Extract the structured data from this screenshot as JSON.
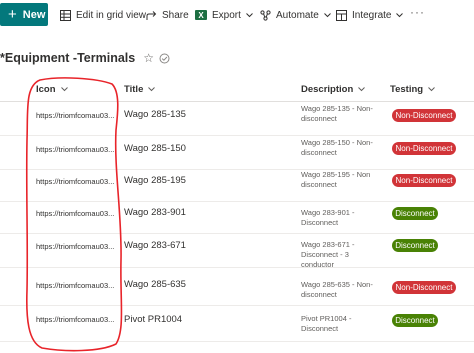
{
  "toolbar": {
    "new_label": "New",
    "edit_grid_label": "Edit in grid view",
    "share_label": "Share",
    "export_label": "Export",
    "automate_label": "Automate",
    "integrate_label": "Integrate",
    "more_label": "···"
  },
  "list": {
    "title": "*Equipment -Terminals",
    "star": "☆"
  },
  "columns": {
    "icon": "Icon",
    "title": "Title",
    "description": "Description",
    "testing": "Testing"
  },
  "rows": [
    {
      "icon": "https://triomfcomau03...",
      "title": "Wago 285-135",
      "desc1": "Wago 285-135 - Non-",
      "desc2": "disconnect",
      "desc3": "",
      "testing": "Non-Disconnect",
      "status": "red"
    },
    {
      "icon": "https://triomfcomau03...",
      "title": "Wago 285-150",
      "desc1": "Wago 285-150 - Non-",
      "desc2": "disconnect",
      "desc3": "",
      "testing": "Non-Disconnect",
      "status": "red"
    },
    {
      "icon": "https://triomfcomau03...",
      "title": "Wago 285-195",
      "desc1": "Wago 285-195 - Non",
      "desc2": "disconnect",
      "desc3": "",
      "testing": "Non-Disconnect",
      "status": "red"
    },
    {
      "icon": "https://triomfcomau03...",
      "title": "Wago 283-901",
      "desc1": "Wago 283-901 -",
      "desc2": "Disconnect",
      "desc3": "",
      "testing": "Disconnect",
      "status": "green"
    },
    {
      "icon": "https://triomfcomau03...",
      "title": "Wago 283-671",
      "desc1": "Wago 283-671 -",
      "desc2": "Disconnect - 3",
      "desc3": "conductor",
      "testing": "Disconnect",
      "status": "green"
    },
    {
      "icon": "https://triomfcomau03...",
      "title": "Wago 285-635",
      "desc1": "Wago 285-635 - Non-",
      "desc2": "disconnect",
      "desc3": "",
      "testing": "Non-Disconnect",
      "status": "red"
    },
    {
      "icon": "https://triomfcomau03...",
      "title": "Pivot PR1004",
      "desc1": "Pivot PR1004 -",
      "desc2": "Disconnect",
      "desc3": "",
      "testing": "Disconnect",
      "status": "green"
    }
  ],
  "colors": {
    "accent": "#03787c",
    "badge_red": "#d13438",
    "badge_green": "#498205",
    "annotation": "#e8242a"
  }
}
